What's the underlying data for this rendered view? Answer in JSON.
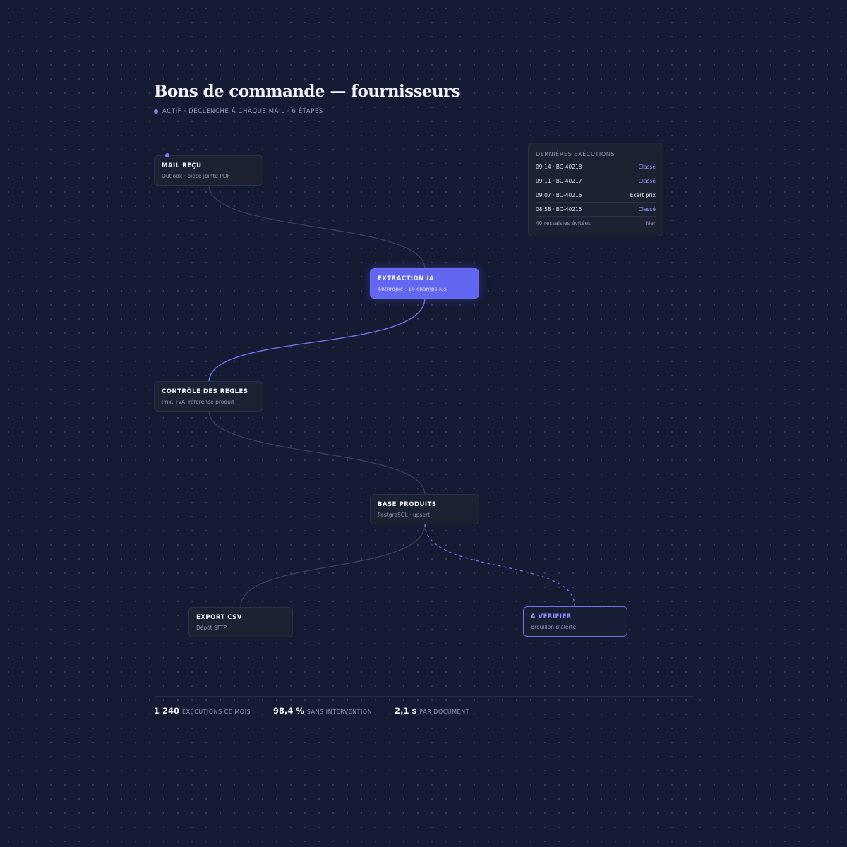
{
  "workflow": {
    "title": "Bons de commande — fournisseurs",
    "status_line": "Actif · déclenché à chaque mail · 6 étapes",
    "status_color": "#7b7ff5"
  },
  "nodes": {
    "mail": {
      "title": "Mail reçu",
      "subtitle": "Outlook · pièce jointe PDF"
    },
    "extraction": {
      "title": "Extraction IA",
      "subtitle": "Anthropic · 14 champs lus"
    },
    "controle": {
      "title": "Contrôle des règles",
      "subtitle": "Prix, TVA, référence produit"
    },
    "base": {
      "title": "Base produits",
      "subtitle": "PostgreSQL · upsert"
    },
    "export": {
      "title": "Export CSV",
      "subtitle": "Dépôt SFTP"
    },
    "verifier": {
      "title": "À vérifier",
      "subtitle": "Brouillon d'alerte"
    }
  },
  "executions": {
    "title": "Dernières exécutions",
    "rows": [
      {
        "label": "09:14 · BC-40218",
        "status": "Classé"
      },
      {
        "label": "09:11 · BC-40217",
        "status": "Classé"
      },
      {
        "label": "09:07 · BC-40216",
        "status": "Écart prix"
      },
      {
        "label": "08:58 · BC-40215",
        "status": "Classé"
      }
    ],
    "footer": {
      "label": "40 ressaisies évitées",
      "value": "hier"
    }
  },
  "stats": [
    {
      "value": "1 240",
      "label": "exécutions ce mois"
    },
    {
      "value": "98,4 %",
      "label": "sans intervention"
    },
    {
      "value": "2,1 s",
      "label": "par document"
    }
  ],
  "colors": {
    "background": "#151b33",
    "accent": "#6366f1",
    "link": "#3c4257",
    "active_link": "#6e72ee"
  }
}
